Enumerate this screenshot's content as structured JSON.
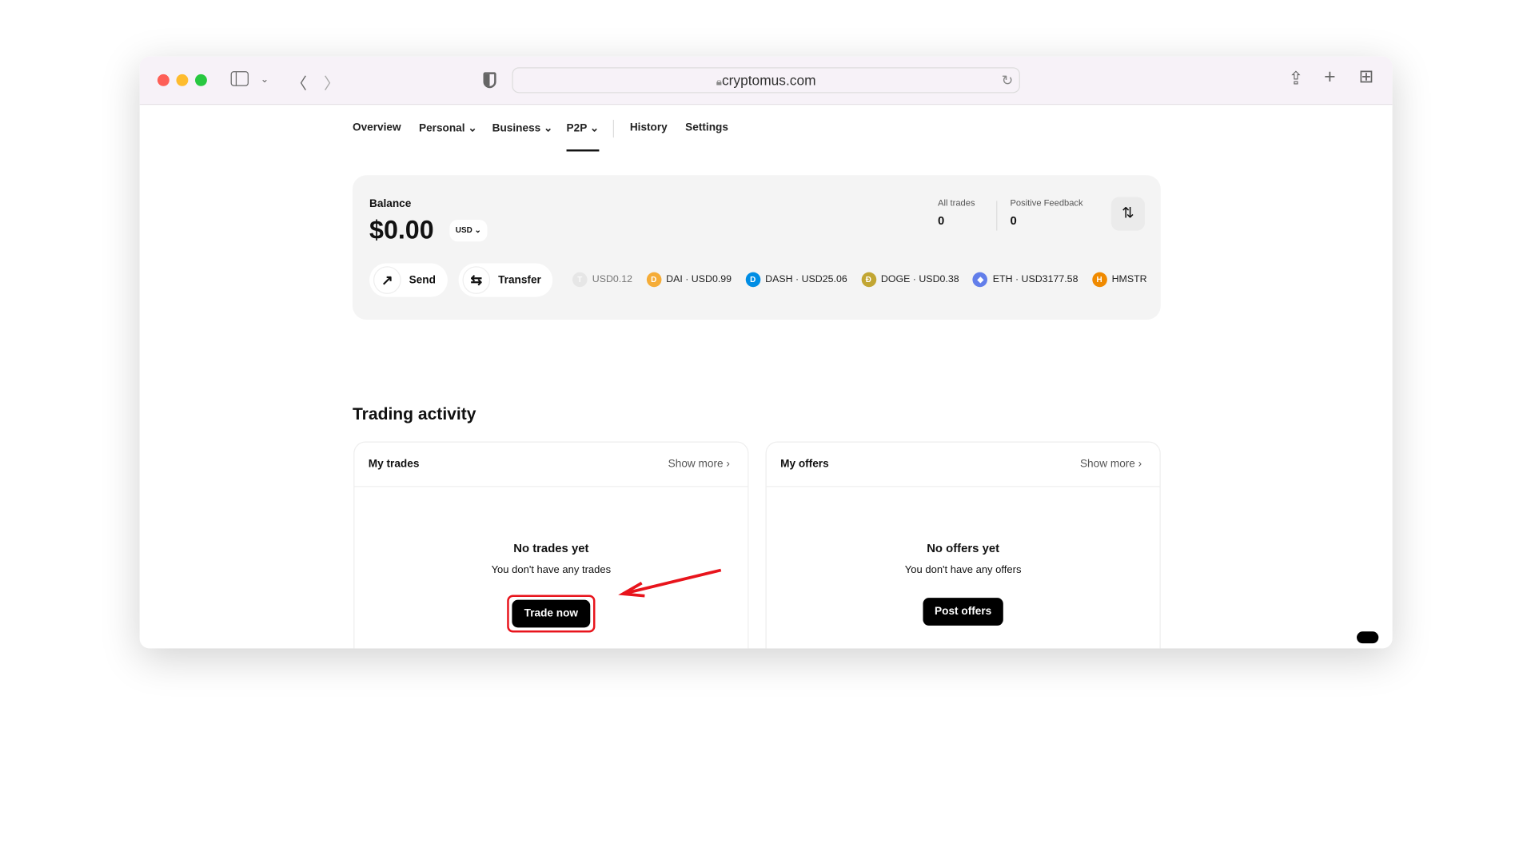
{
  "browser": {
    "url": "cryptomus.com"
  },
  "nav": {
    "items": [
      {
        "label": "Overview"
      },
      {
        "label": "Personal",
        "dropdown": true
      },
      {
        "label": "Business",
        "dropdown": true
      },
      {
        "label": "P2P",
        "dropdown": true,
        "active": true
      },
      {
        "label": "History"
      },
      {
        "label": "Settings"
      }
    ]
  },
  "balance": {
    "label": "Balance",
    "amount": "$0.00",
    "currency": "USD",
    "all_trades_label": "All trades",
    "all_trades": "0",
    "feedback_label": "Positive Feedback",
    "feedback": "0",
    "send": "Send",
    "transfer": "Transfer"
  },
  "coins": [
    {
      "name": "",
      "price": "USD0.12",
      "color": "#dddddd",
      "glyph": "T"
    },
    {
      "name": "DAI",
      "price": "USD0.99",
      "color": "#f5ac37",
      "glyph": "D"
    },
    {
      "name": "DASH",
      "price": "USD25.06",
      "color": "#008de4",
      "glyph": "D"
    },
    {
      "name": "DOGE",
      "price": "USD0.38",
      "color": "#c2a633",
      "glyph": "Ð"
    },
    {
      "name": "ETH",
      "price": "USD3177.58",
      "color": "#627eea",
      "glyph": "◆"
    },
    {
      "name": "HMSTR",
      "price": "",
      "color": "#f08a00",
      "glyph": "H"
    }
  ],
  "trading": {
    "title": "Trading activity",
    "my_trades": {
      "title": "My trades",
      "show_more": "Show more",
      "empty_title": "No trades yet",
      "empty_text": "You don't have any trades",
      "button": "Trade now"
    },
    "my_offers": {
      "title": "My offers",
      "show_more": "Show more",
      "empty_title": "No offers yet",
      "empty_text": "You don't have any offers",
      "button": "Post offers"
    }
  },
  "annotation_color": "#e8141c"
}
